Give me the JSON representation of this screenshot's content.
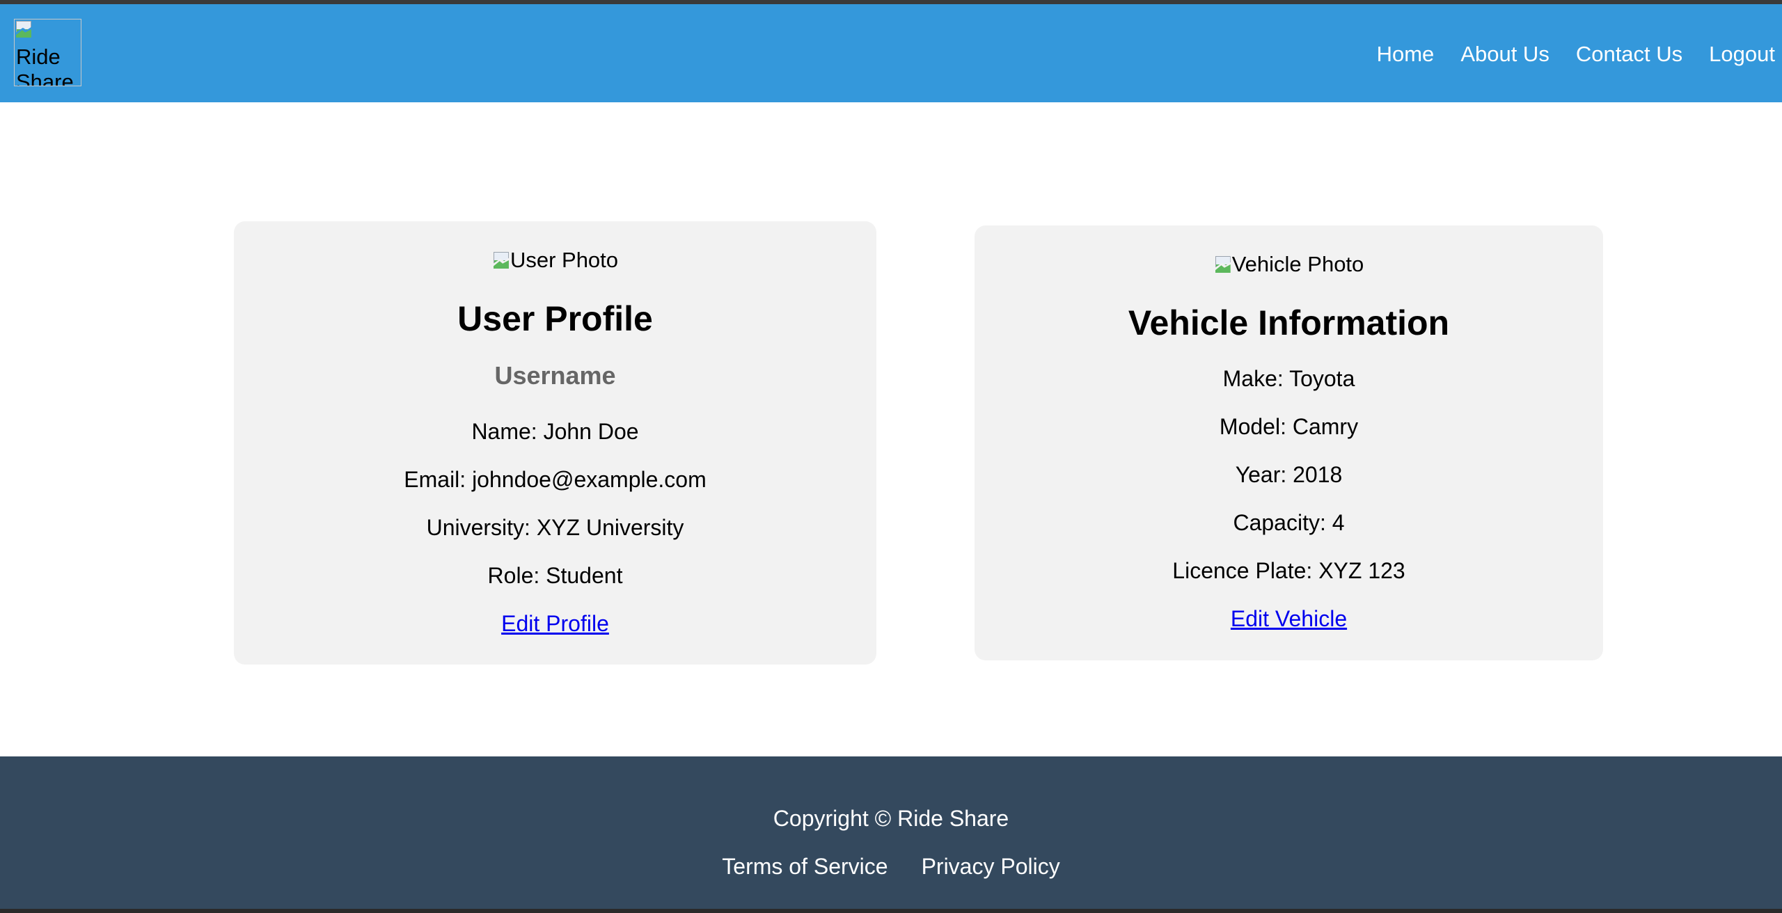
{
  "header": {
    "logo_alt": "Ride Share",
    "nav": {
      "home": "Home",
      "about": "About Us",
      "contact": "Contact Us",
      "logout": "Logout"
    }
  },
  "user_card": {
    "photo_alt": "User Photo",
    "title": "User Profile",
    "subtitle": "Username",
    "name": "Name: John Doe",
    "email": "Email: johndoe@example.com",
    "university": "University: XYZ University",
    "role": "Role: Student",
    "edit_link": "Edit Profile"
  },
  "vehicle_card": {
    "photo_alt": "Vehicle Photo",
    "title": "Vehicle Information",
    "make": "Make: Toyota",
    "model": "Model: Camry",
    "year": "Year: 2018",
    "capacity": "Capacity: 4",
    "plate": "Licence Plate: XYZ 123",
    "edit_link": "Edit Vehicle"
  },
  "footer": {
    "copyright": "Copyright © Ride Share",
    "terms": "Terms of Service",
    "privacy": "Privacy Policy"
  },
  "colors": {
    "header_bg": "#3498db",
    "footer_bg": "#34495e",
    "card_bg": "#f2f2f2",
    "link": "#0000ee",
    "subtitle": "#666666"
  },
  "icons": {
    "broken_image": "broken-image-icon"
  }
}
